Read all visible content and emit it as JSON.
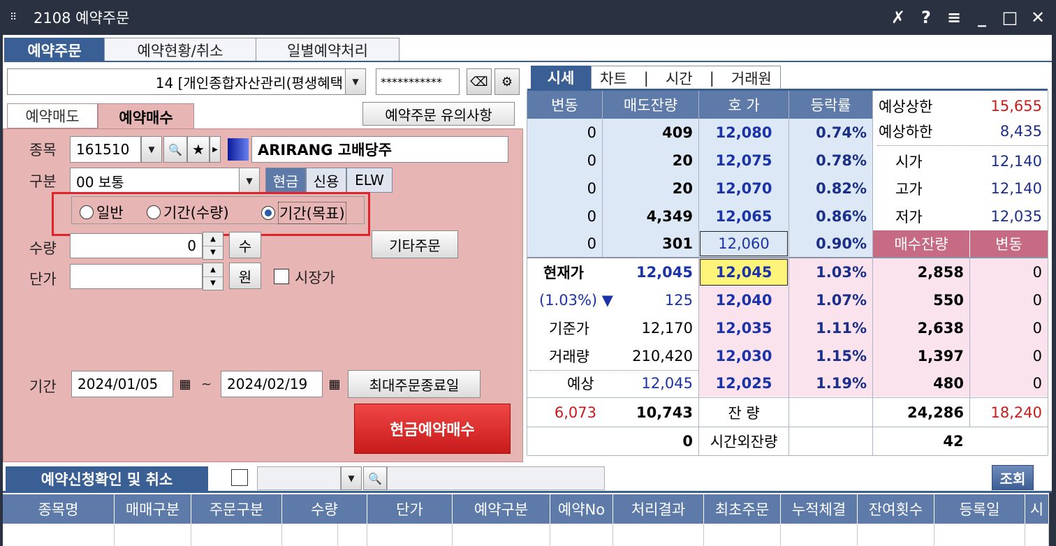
{
  "window": {
    "title": "2108 예약주문",
    "grip_glyph": "⠿",
    "controls": [
      "✗",
      "?",
      "≡",
      "_",
      "□",
      "✕"
    ]
  },
  "top_tabs": [
    {
      "label": "예약주문",
      "active": true
    },
    {
      "label": "예약현황/취소",
      "active": false
    },
    {
      "label": "일별예약처리",
      "active": false
    }
  ],
  "account": {
    "value": "14 [개인종합자산관리(평생혜택",
    "password": "***********",
    "dropdown_glyph": "▼",
    "eraser_glyph": "⌫",
    "gear_glyph": "⚙"
  },
  "sub_tabs": [
    {
      "label": "예약매도",
      "active": false
    },
    {
      "label": "예약매수",
      "active": true
    }
  ],
  "notice_button": "예약주문 유의사항",
  "form": {
    "stock_label": "종목",
    "stock_code": "161510",
    "stock_name": "ARIRANG 고배당주",
    "type_label": "구분",
    "type_value": "00 보통",
    "seg": [
      "현금",
      "신용",
      "ELW"
    ],
    "radios": [
      {
        "label": "일반",
        "checked": false
      },
      {
        "label": "기간(수량)",
        "checked": false
      },
      {
        "label": "기간(목표)",
        "checked": true
      }
    ],
    "qty_label": "수량",
    "qty_value": "0",
    "qty_unit": "수",
    "price_label": "단가",
    "price_value": "",
    "price_unit": "원",
    "market_price_label": "시장가",
    "other_order_btn": "기타주문",
    "period_label": "기간",
    "date_from": "2024/01/05",
    "date_sep": "~",
    "date_to": "2024/02/19",
    "max_end_btn": "최대주문종료일",
    "submit_btn": "현금예약매수"
  },
  "icons": {
    "search": "🔍",
    "star": "★",
    "play": "▶",
    "calendar": "▦",
    "up": "▲",
    "down": "▼"
  },
  "quote_tabs": {
    "active": "시세",
    "others": [
      "차트",
      "시간",
      "거래원"
    ],
    "sep": "|"
  },
  "quote": {
    "headers": [
      "변동",
      "매도잔량",
      "호 가",
      "등락률"
    ],
    "asks": [
      {
        "chg": "0",
        "qty": "409",
        "price": "12,080",
        "rate": "0.74%"
      },
      {
        "chg": "0",
        "qty": "20",
        "price": "12,075",
        "rate": "0.78%"
      },
      {
        "chg": "0",
        "qty": "20",
        "price": "12,070",
        "rate": "0.82%"
      },
      {
        "chg": "0",
        "qty": "4,349",
        "price": "12,065",
        "rate": "0.86%"
      },
      {
        "chg": "0",
        "qty": "301",
        "price": "12,060",
        "rate": "0.90%"
      }
    ],
    "side_info": [
      {
        "label": "예상상한",
        "value": "15,655"
      },
      {
        "label": "예상하한",
        "value": "8,435"
      },
      {
        "label": "시가",
        "value": "12,140"
      },
      {
        "label": "고가",
        "value": "12,140"
      },
      {
        "label": "저가",
        "value": "12,035"
      }
    ],
    "bid_headers": [
      "매수잔량",
      "변동"
    ],
    "bids": [
      {
        "price": "12,045",
        "rate": "1.03%",
        "qty": "2,858",
        "chg": "0"
      },
      {
        "price": "12,040",
        "rate": "1.07%",
        "qty": "550",
        "chg": "0"
      },
      {
        "price": "12,035",
        "rate": "1.11%",
        "qty": "2,638",
        "chg": "0"
      },
      {
        "price": "12,030",
        "rate": "1.15%",
        "qty": "1,397",
        "chg": "0"
      },
      {
        "price": "12,025",
        "rate": "1.19%",
        "qty": "480",
        "chg": "0"
      }
    ],
    "left_info": [
      {
        "label": "현재가",
        "value": "12,045"
      },
      {
        "label": "(1.03%) ▼",
        "value": "125"
      },
      {
        "label": "기준가",
        "value": "12,170"
      },
      {
        "label": "거래량",
        "value": "210,420"
      },
      {
        "label": "예상",
        "value": "12,045"
      }
    ],
    "totals": {
      "ask_chg": "6,073",
      "ask_qty": "10,743",
      "label": "잔 량",
      "bid_qty": "24,286",
      "bid_chg": "18,240"
    },
    "after": {
      "ask_qty": "0",
      "label": "시간외잔량",
      "bid_qty": "42"
    }
  },
  "bottom": {
    "tab": "예약신청확인 및 취소",
    "query_btn": "조회",
    "columns": [
      "종목명",
      "매매구분",
      "주문구분",
      "수량",
      "단가",
      "예약구분",
      "예약No",
      "처리결과",
      "최초주문",
      "누적체결",
      "잔여횟수",
      "등록일",
      "시"
    ]
  }
}
